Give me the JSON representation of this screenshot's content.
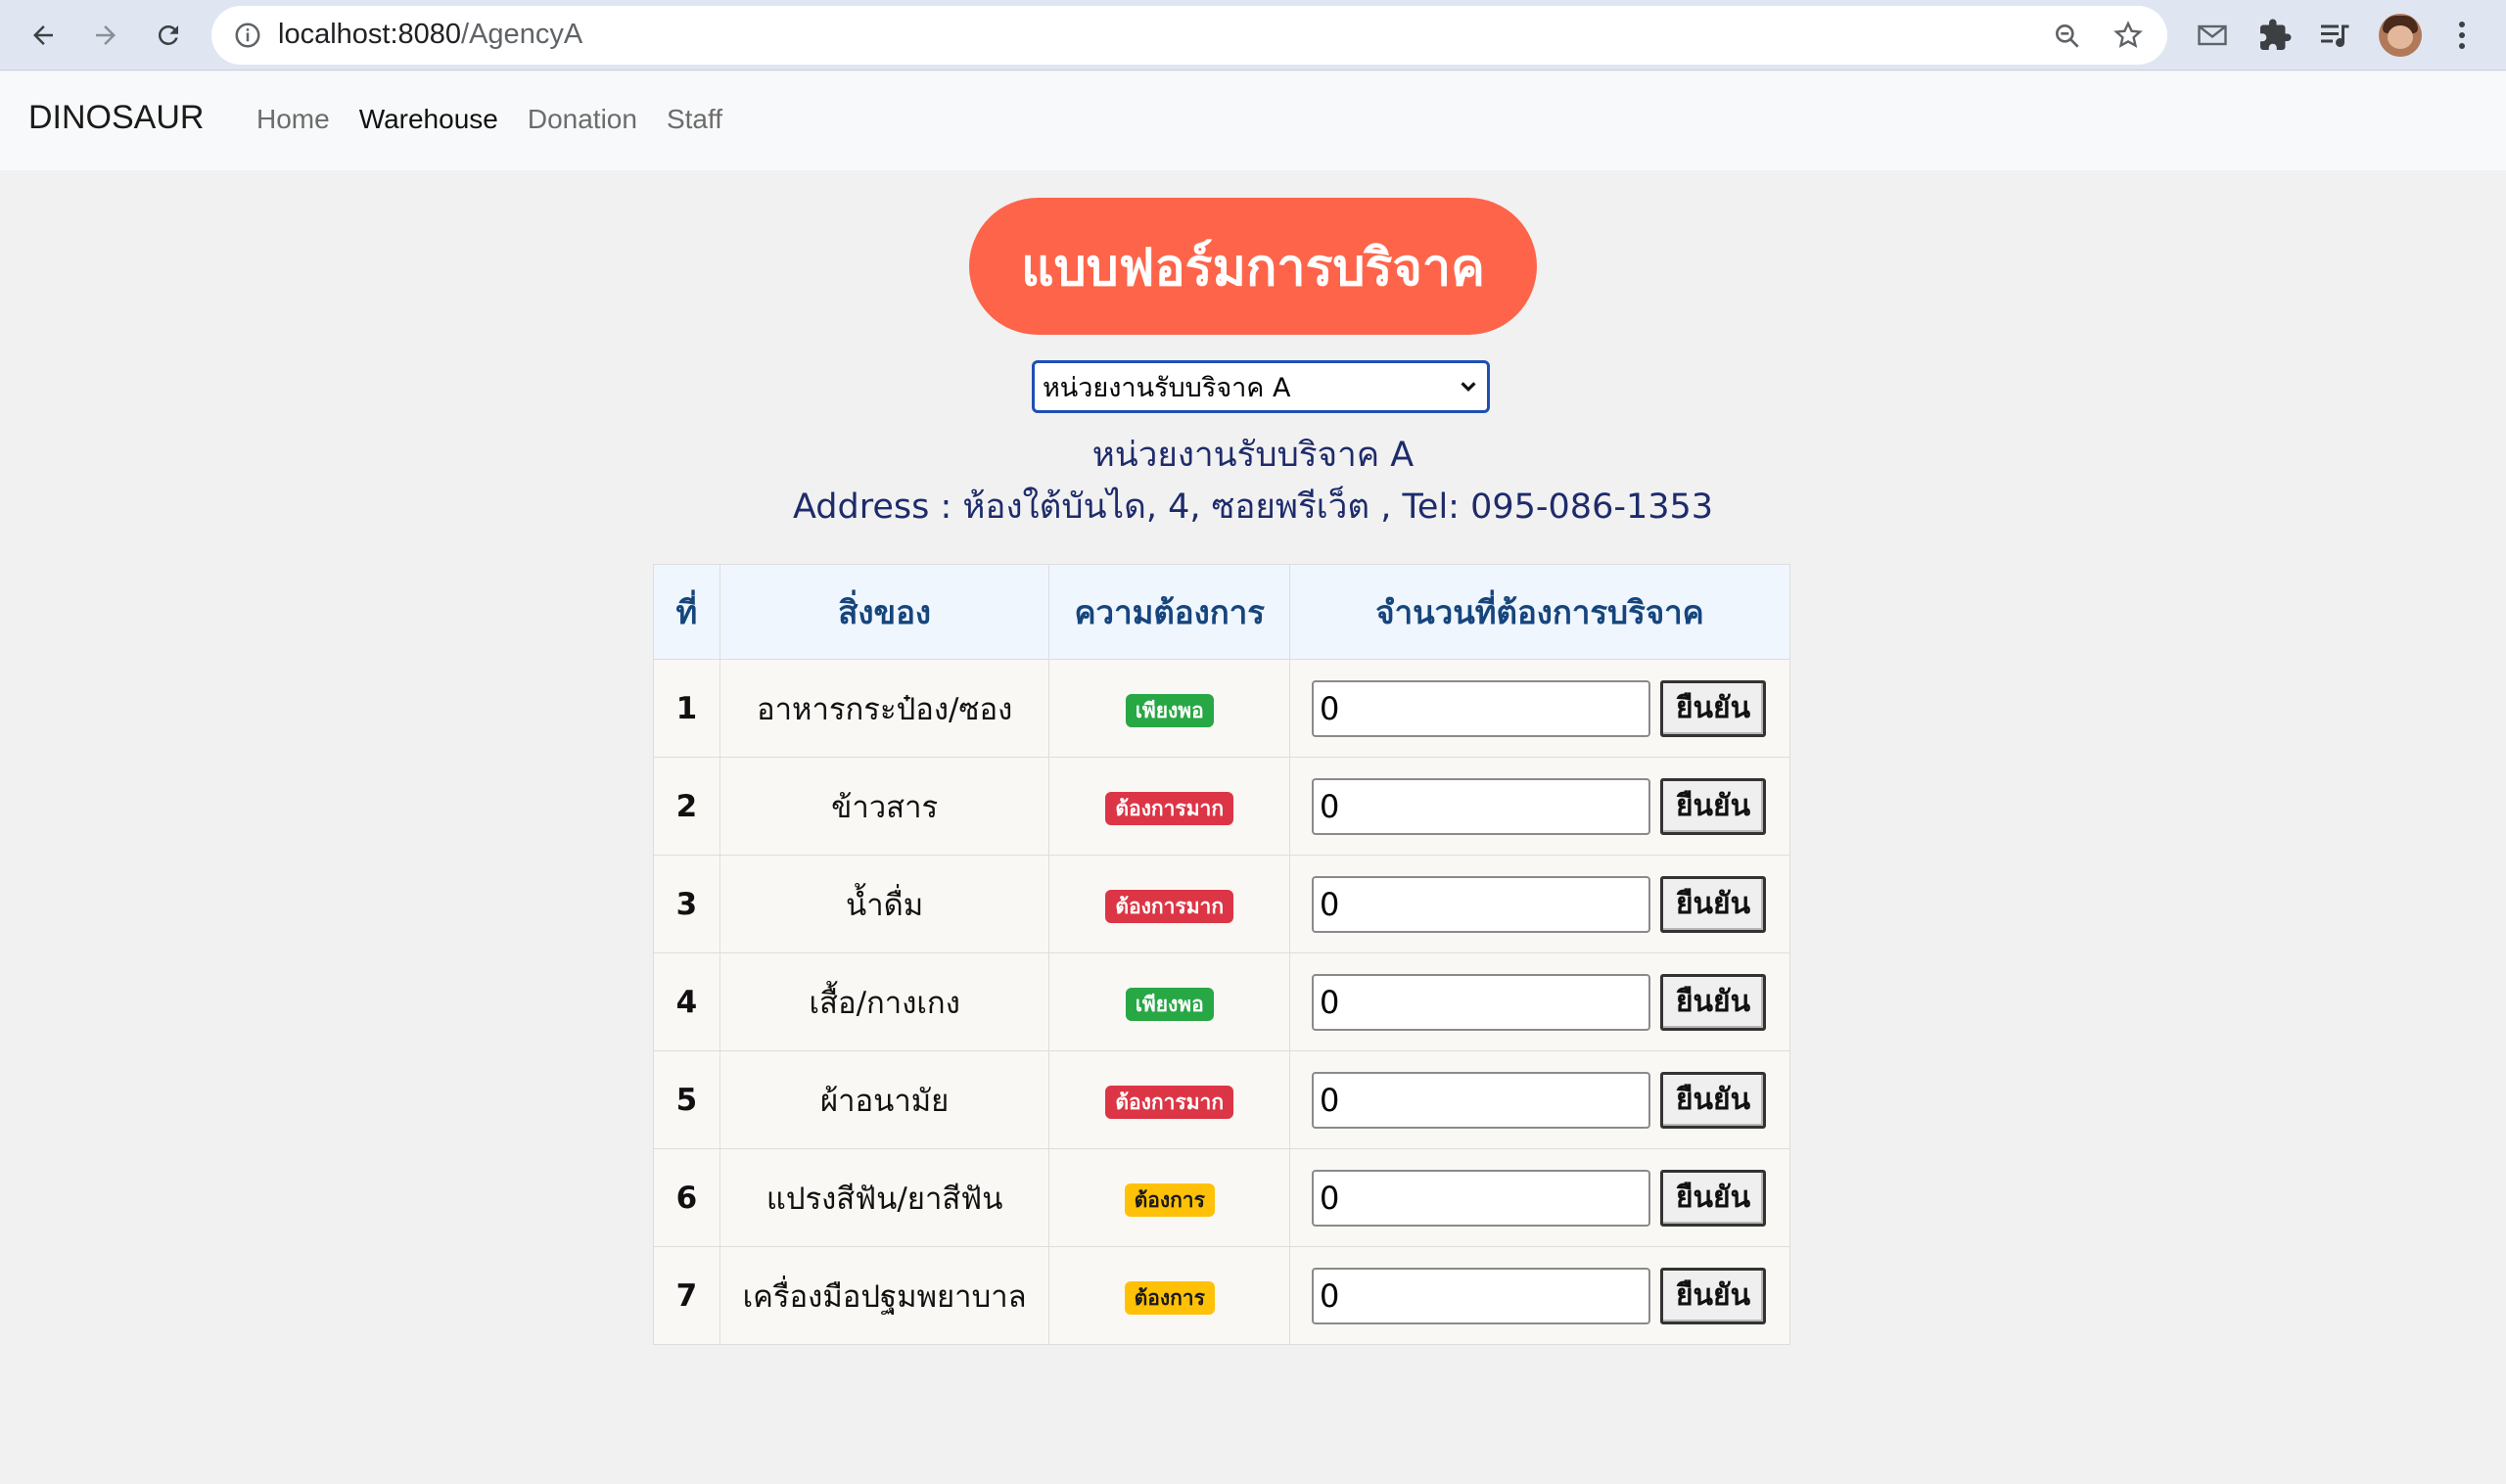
{
  "browser": {
    "url_host": "localhost:8080",
    "url_path": "/AgencyA"
  },
  "navbar": {
    "brand": "DINOSAUR",
    "links": [
      {
        "label": "Home",
        "active": false
      },
      {
        "label": "Warehouse",
        "active": true
      },
      {
        "label": "Donation",
        "active": false
      },
      {
        "label": "Staff",
        "active": false
      }
    ]
  },
  "main": {
    "title": "แบบฟอร์มการบริจาค",
    "agency_select": {
      "selected": "หน่วยงานรับบริจาค A"
    },
    "agency_name": "หน่วยงานรับบริจาค A",
    "agency_address": "Address : ห้องใต้บันได, 4, ซอยพรีเว็ต , Tel: 095-086-1353"
  },
  "table": {
    "headers": [
      "ที่",
      "สิ่งของ",
      "ความต้องการ",
      "จำนวนที่ต้องการบริจาค"
    ],
    "confirm_label": "ยืนยัน",
    "rows": [
      {
        "no": "1",
        "item": "อาหารกระป๋อง/ซอง",
        "need": "เพียงพอ",
        "need_color": "#28a745",
        "qty": "0"
      },
      {
        "no": "2",
        "item": "ข้าวสาร",
        "need": "ต้องการมาก",
        "need_color": "#dc3545",
        "qty": "0"
      },
      {
        "no": "3",
        "item": "น้ำดื่ม",
        "need": "ต้องการมาก",
        "need_color": "#dc3545",
        "qty": "0"
      },
      {
        "no": "4",
        "item": "เสื้อ/กางเกง",
        "need": "เพียงพอ",
        "need_color": "#28a745",
        "qty": "0"
      },
      {
        "no": "5",
        "item": "ผ้าอนามัย",
        "need": "ต้องการมาก",
        "need_color": "#dc3545",
        "qty": "0"
      },
      {
        "no": "6",
        "item": "แปรงสีฟัน/ยาสีฟัน",
        "need": "ต้องการ",
        "need_color": "#ffc107",
        "qty": "0"
      },
      {
        "no": "7",
        "item": "เครื่องมือปฐมพยาบาล",
        "need": "ต้องการ",
        "need_color": "#ffc107",
        "qty": "0"
      }
    ]
  },
  "colors": {
    "title_pill": "#fe644a",
    "header_text": "#16457d",
    "agency_text": "#1e2b6b"
  }
}
